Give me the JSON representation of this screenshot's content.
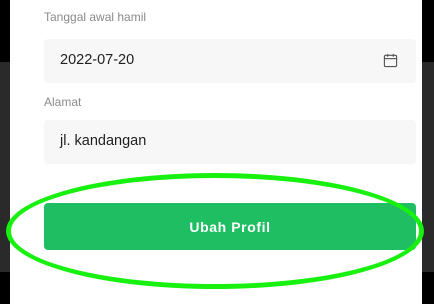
{
  "form": {
    "pregnancy_start": {
      "label": "Tanggal awal hamil",
      "value": "2022-07-20",
      "icon": "calendar-icon"
    },
    "address": {
      "label": "Alamat",
      "value": "jl. kandangan"
    },
    "submit_label": "Ubah Profil"
  },
  "colors": {
    "button": "#1fbe63",
    "highlight": "#18f00f",
    "field_background": "#f7f7f7"
  }
}
